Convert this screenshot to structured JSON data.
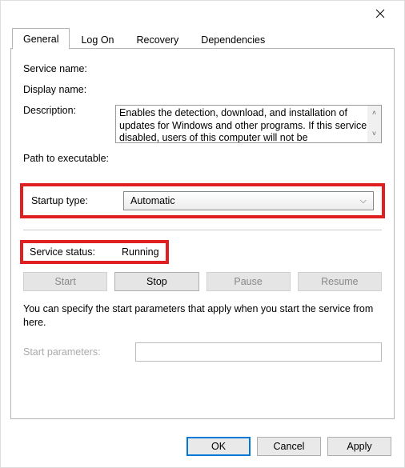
{
  "tabs": {
    "general": "General",
    "logon": "Log On",
    "recovery": "Recovery",
    "dependencies": "Dependencies"
  },
  "labels": {
    "service_name": "Service name:",
    "display_name": "Display name:",
    "description": "Description:",
    "path": "Path to executable:",
    "startup_type": "Startup type:",
    "service_status": "Service status:",
    "start_params": "Start parameters:"
  },
  "values": {
    "service_name": "",
    "display_name": "",
    "description": "Enables the detection, download, and installation of updates for Windows and other programs. If this service is disabled, users of this computer will not be",
    "path": "",
    "startup_type": "Automatic",
    "service_status": "Running",
    "start_params": ""
  },
  "buttons": {
    "start": "Start",
    "stop": "Stop",
    "pause": "Pause",
    "resume": "Resume",
    "ok": "OK",
    "cancel": "Cancel",
    "apply": "Apply"
  },
  "note": "You can specify the start parameters that apply when you start the service from here.",
  "button_states": {
    "start": false,
    "stop": true,
    "pause": false,
    "resume": false
  }
}
